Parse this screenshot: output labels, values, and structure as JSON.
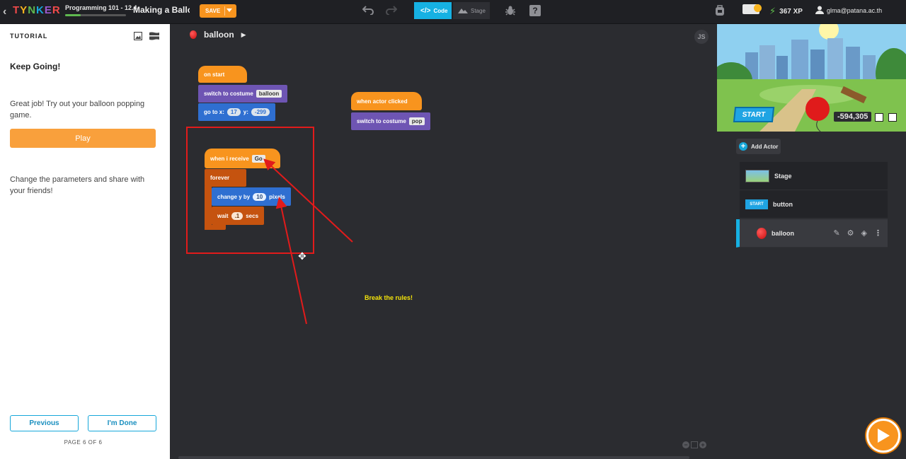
{
  "topbar": {
    "logo_letters": [
      "T",
      "Y",
      "N",
      "K",
      "E",
      "R"
    ],
    "course": "Programming 101 - 12.4",
    "course_progress": 0.25,
    "project_title": "Making a Balloon",
    "save_label": "SAVE",
    "code_tab": "Code",
    "stage_tab": "Stage",
    "help_label": "?",
    "xp": "367 XP",
    "user_email": "glma@patana.ac.th"
  },
  "tutorial": {
    "header": "TUTORIAL",
    "title": "Keep Going!",
    "para1": "Great job! Try out your balloon popping game.",
    "play_label": "Play",
    "para2": "Change the parameters and share with your friends!",
    "previous_label": "Previous",
    "done_label": "I'm Done",
    "page_indicator": "PAGE 6 OF 6"
  },
  "workspace": {
    "actor_name": "balloon",
    "js_label": "JS",
    "annotation": "Break the rules!",
    "blocks": {
      "on_start": "on start",
      "switch_costume": "switch to costume",
      "costume1": "balloon",
      "go_to_x": "go to x:",
      "x_val": "17",
      "y_label": "y:",
      "y_val": "-299",
      "when_clicked": "when actor clicked",
      "switch_costume2": "switch to costume",
      "costume2": "pop",
      "when_receive": "when i receive",
      "msg": "Go",
      "forever": "forever",
      "change_y": "change y by",
      "change_val": "10",
      "pixels": "pixels",
      "wait": "wait",
      "wait_val": ".1",
      "secs": "secs"
    }
  },
  "right": {
    "start_label": "START",
    "coords": "-594,305",
    "add_actor": "Add Actor",
    "actors": [
      {
        "name": "Stage"
      },
      {
        "name": "button",
        "thumb": "START"
      },
      {
        "name": "balloon"
      }
    ]
  },
  "colors": {
    "accent": "#16b1e3",
    "orange": "#f8941e",
    "annotation": "#e11b1b",
    "annotation_text": "#f4e40a"
  }
}
